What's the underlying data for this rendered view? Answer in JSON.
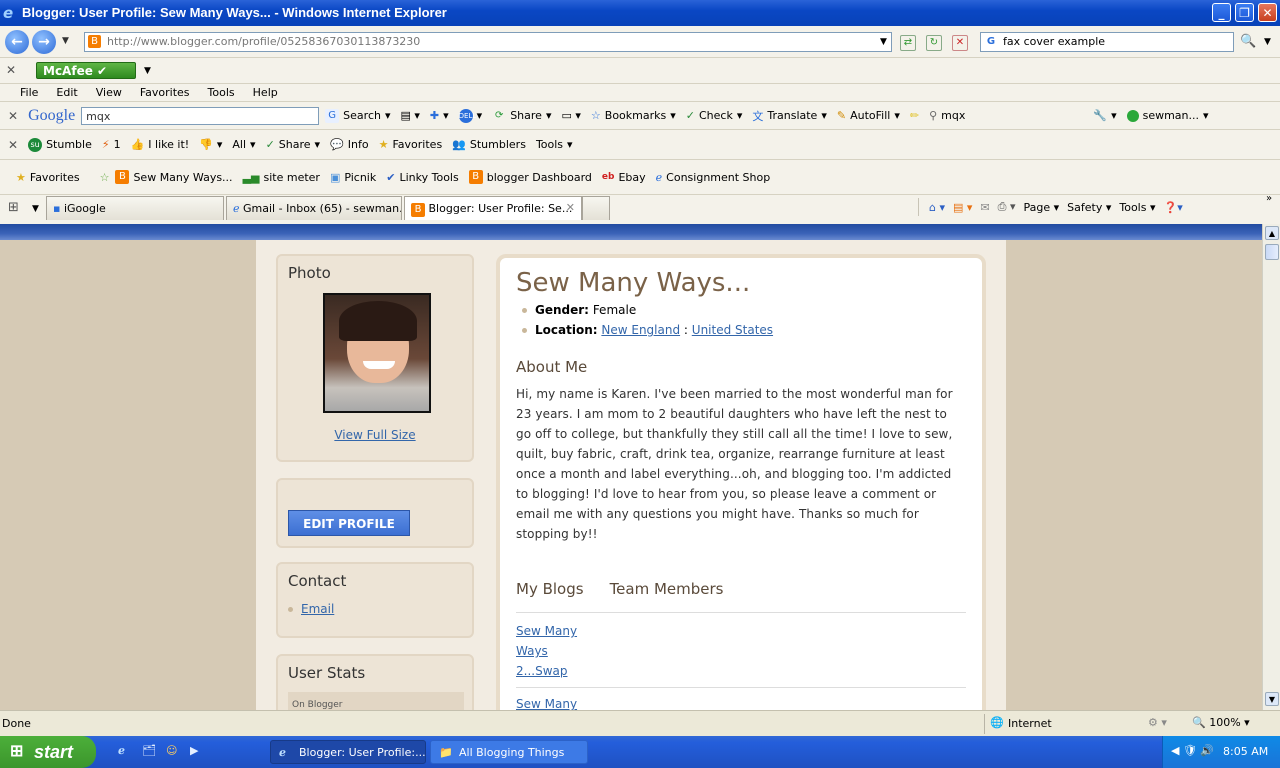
{
  "window": {
    "title": "Blogger: User Profile: Sew Many Ways... - Windows Internet Explorer"
  },
  "address": {
    "url": "http://www.blogger.com/profile/05258367030113873230",
    "search_value": "fax cover example"
  },
  "mcafee": {
    "label": "McAfee"
  },
  "menu": [
    "File",
    "Edit",
    "View",
    "Favorites",
    "Tools",
    "Help"
  ],
  "google_toolbar": {
    "logo": "Google",
    "query": "mqx",
    "search": "Search",
    "share": "Share",
    "bookmarks": "Bookmarks",
    "check": "Check",
    "translate": "Translate",
    "autofill": "AutoFill",
    "mqx": "mqx",
    "account": "sewman..."
  },
  "stumble_toolbar": {
    "stumble": "Stumble",
    "count": "1",
    "ilike": "I like it!",
    "all": "All",
    "share": "Share",
    "info": "Info",
    "favorites": "Favorites",
    "stumblers": "Stumblers",
    "tools": "Tools"
  },
  "favorites_bar": {
    "favorites": "Favorites",
    "items": [
      "Sew Many Ways...",
      "site meter",
      "Picnik",
      "Linky Tools",
      "blogger Dashboard",
      "Ebay",
      "Consignment Shop"
    ]
  },
  "tabs": [
    {
      "label": "iGoogle"
    },
    {
      "label": "Gmail - Inbox (65) - sewman..."
    },
    {
      "label": "Blogger: User Profile: Se..."
    }
  ],
  "command_bar": {
    "page": "Page",
    "safety": "Safety",
    "tools": "Tools"
  },
  "profile": {
    "photo_heading": "Photo",
    "view_full": "View Full Size",
    "edit_profile": "EDIT PROFILE",
    "contact_heading": "Contact",
    "email": "Email",
    "stats_heading": "User Stats",
    "stats_first": "On Blogger",
    "name": "Sew Many Ways...",
    "gender_label": "Gender:",
    "gender": "Female",
    "location_label": "Location:",
    "region": "New England",
    "sep": ":",
    "country": "United States",
    "about_heading": "About Me",
    "about_text": "Hi, my name is Karen. I've been married to the most wonderful man for 23 years. I am mom to 2 beautiful daughters who have left the nest to go off to college, but thankfully they still call all the time! I love to sew, quilt, buy fabric, craft, drink tea, organize, rearrange furniture at least once a month and label everything...oh, and blogging too. I'm addicted to blogging! I'd love to hear from you, so please leave a comment or email me with any questions you might have. Thanks so much for stopping by!!",
    "my_blogs": "My Blogs",
    "team_members": "Team Members",
    "blogs": [
      "Sew Many Ways 2...Swap",
      "Sew Many"
    ]
  },
  "status": {
    "text": "Done",
    "zone": "Internet",
    "zoom": "100%"
  },
  "taskbar": {
    "start": "start",
    "tasks": [
      "Blogger: User Profile:...",
      "All Blogging Things"
    ],
    "clock": "8:05 AM"
  }
}
